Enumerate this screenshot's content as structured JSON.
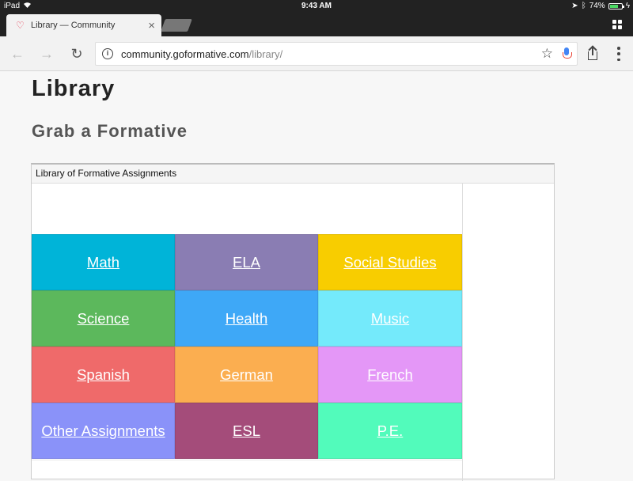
{
  "status_bar": {
    "device": "iPad",
    "time": "9:43 AM",
    "battery": "74%",
    "battery_level": 0.74
  },
  "tab": {
    "title": "Library — Community",
    "close_label": "×"
  },
  "address_bar": {
    "host": "community.goformative.com",
    "path": "/library/"
  },
  "page": {
    "heading": "Library",
    "subheading": "Grab a Formative",
    "panel_title": "Library of Formative Assignments"
  },
  "subjects": [
    {
      "label": "Math",
      "color": "#00b4d8"
    },
    {
      "label": "ELA",
      "color": "#8a7db3"
    },
    {
      "label": "Social Studies",
      "color": "#f8cd00"
    },
    {
      "label": "Science",
      "color": "#5cb85c"
    },
    {
      "label": "Health",
      "color": "#3ea8f7"
    },
    {
      "label": "Music",
      "color": "#74eafb"
    },
    {
      "label": "Spanish",
      "color": "#ef6a6a"
    },
    {
      "label": "German",
      "color": "#fbae50"
    },
    {
      "label": "French",
      "color": "#e497f7"
    },
    {
      "label": "Other Assignments",
      "color": "#8a92f9"
    },
    {
      "label": "ESL",
      "color": "#a44c7a"
    },
    {
      "label": "P.E.",
      "color": "#52fbbb"
    }
  ],
  "icons": {
    "wifi": "wifi-icon",
    "location": "location-icon",
    "bluetooth": "bluetooth-icon",
    "battery": "battery-icon",
    "back": "back-arrow-icon",
    "forward": "forward-arrow-icon",
    "reload": "reload-icon",
    "info": "info-icon",
    "star": "star-icon",
    "mic": "microphone-icon",
    "share": "share-icon",
    "menu": "menu-icon",
    "tabs": "tab-switcher-icon"
  }
}
